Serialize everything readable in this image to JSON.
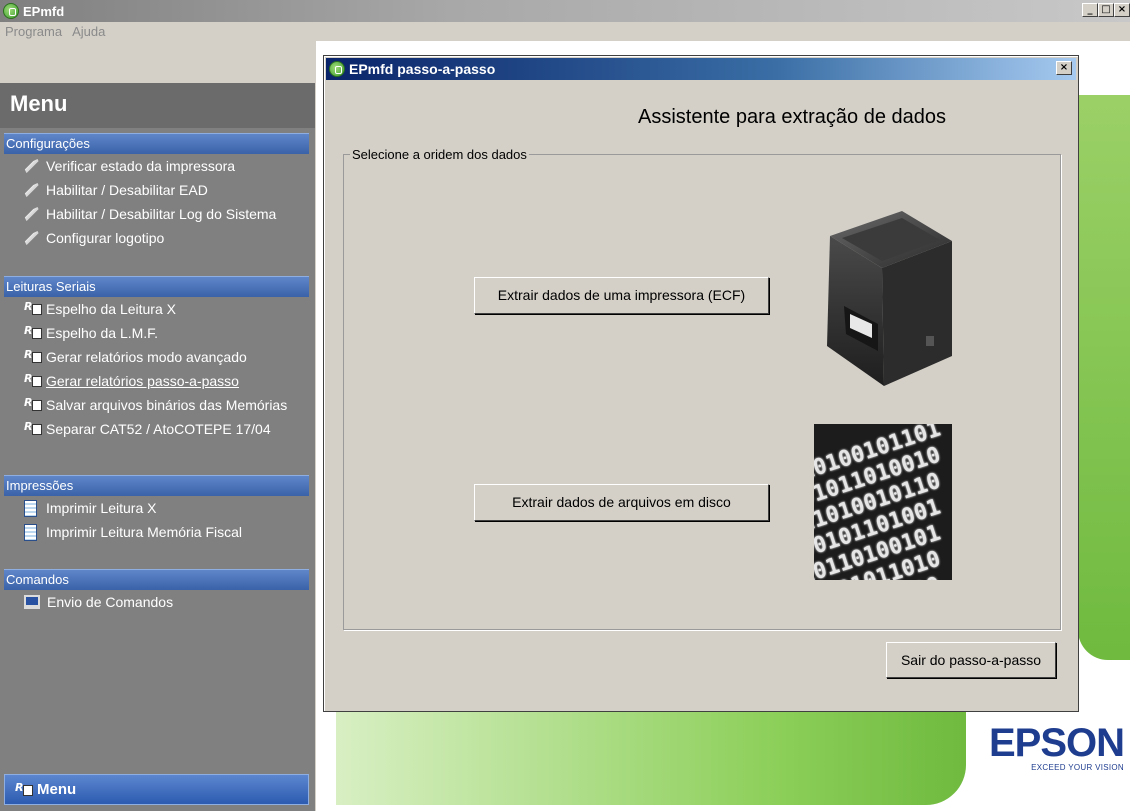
{
  "window": {
    "title": "EPmfd",
    "controls": [
      "_",
      "□",
      "×"
    ]
  },
  "menubar": [
    "Programa",
    "Ajuda"
  ],
  "sidebar": {
    "title": "Menu",
    "sections": [
      {
        "header": "Configurações",
        "items": [
          "Verificar estado da impressora",
          "Habilitar / Desabilitar EAD",
          "Habilitar / Desabilitar Log do Sistema",
          "Configurar logotipo"
        ]
      },
      {
        "header": "Leituras Seriais",
        "items": [
          "Espelho da Leitura X",
          "Espelho da L.M.F.",
          "Gerar relatórios modo avançado",
          "Gerar relatórios passo-a-passo",
          "Salvar arquivos binários das Memórias",
          "Separar CAT52 / AtoCOTEPE 17/04"
        ]
      },
      {
        "header": "Impressões",
        "items": [
          "Imprimir Leitura X",
          "Imprimir Leitura Memória Fiscal"
        ]
      },
      {
        "header": "Comandos",
        "items": [
          "Envio de Comandos"
        ]
      }
    ],
    "footer": "Menu"
  },
  "dialog": {
    "title": "EPmfd passo-a-passo",
    "close": "×",
    "heading": "Assistente para extração de dados",
    "group_label": "Selecione a oridem dos dados",
    "btn_ecf": "Extrair dados de uma impressora (ECF)",
    "btn_disk": "Extrair dados de arquivos em disco",
    "btn_exit": "Sair do passo-a-passo"
  },
  "branding": {
    "logo": "EPSON",
    "tagline": "EXCEED YOUR VISION",
    "accent_green": "#6fba3f",
    "accent_blue": "#1f3d8f"
  }
}
